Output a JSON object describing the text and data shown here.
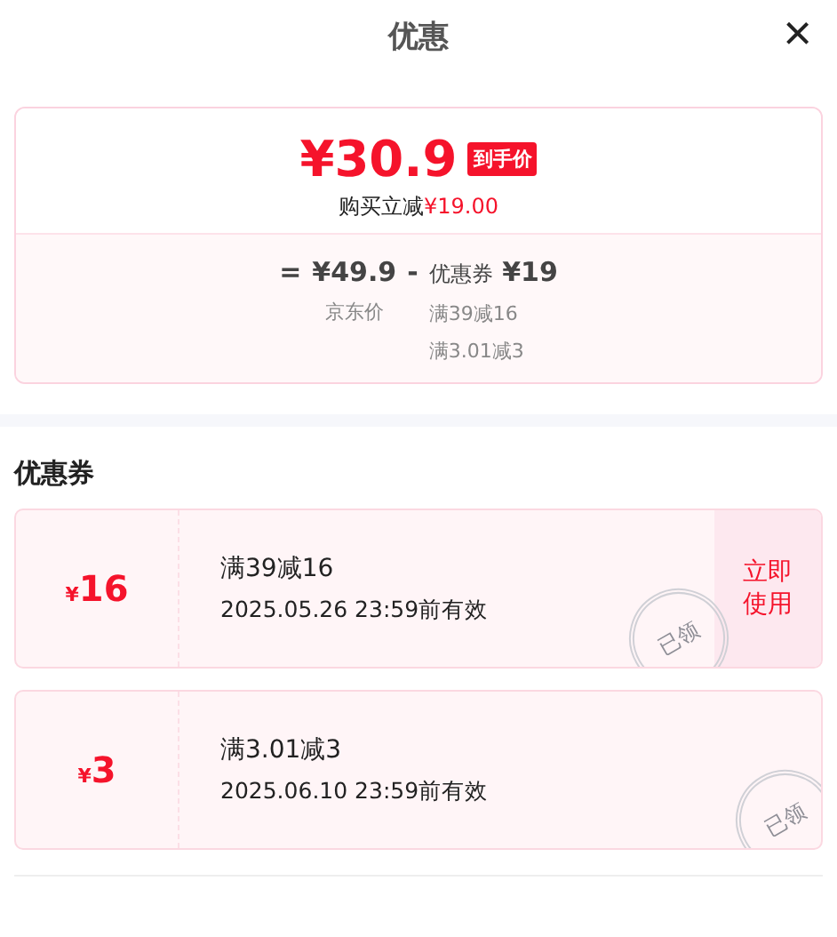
{
  "header": {
    "title": "优惠",
    "close": "×"
  },
  "summary": {
    "currency": "¥",
    "final_price": "30.9",
    "final_tag": "到手价",
    "saving_label": "购买立减",
    "saving_amount": "¥19.00",
    "equals": "=",
    "base_price": "¥49.9",
    "base_label": "京东价",
    "minus": "-",
    "coupon_label": "优惠券",
    "coupon_total": "¥19",
    "coupon_rules": [
      "满39减16",
      "满3.01减3"
    ]
  },
  "section_title": "优惠券",
  "coupons": [
    {
      "currency": "¥",
      "amount": "16",
      "title": "满39减16",
      "validity": "2025.05.26 23:59前有效",
      "stamp": "已领",
      "action": "立即使用"
    },
    {
      "currency": "¥",
      "amount": "3",
      "title": "满3.01减3",
      "validity": "2025.06.10 23:59前有效",
      "stamp": "已领"
    }
  ]
}
